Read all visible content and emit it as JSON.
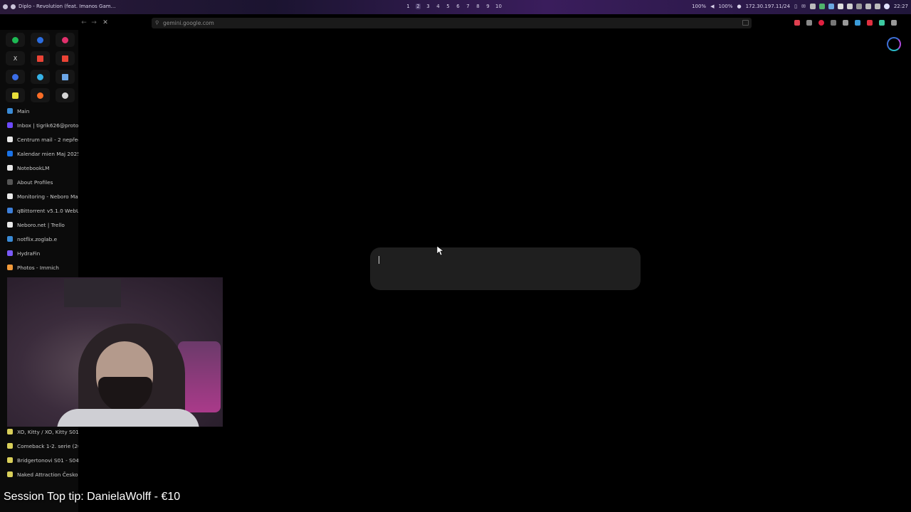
{
  "topbar": {
    "now_playing": "Diplo - Revolution (feat. Imanos Gam…",
    "workspaces": [
      "1",
      "2",
      "3",
      "4",
      "5",
      "6",
      "7",
      "8",
      "9",
      "10"
    ],
    "active_workspace": "2",
    "volume_left": "100%",
    "volume_right": "100%",
    "ip_address": "172.30.197.11/24",
    "clock": "22:27"
  },
  "browser": {
    "url": "gemini.google.com"
  },
  "sidebar": {
    "pinned_icons": [
      "spotify-icon",
      "messenger-icon",
      "instagram-icon",
      "x-icon",
      "gmail-icon",
      "gmail-icon",
      "chat-icon",
      "drop-icon",
      "screen-icon",
      "note-icon",
      "gitlab-icon",
      "circle-icon"
    ],
    "tabs": [
      {
        "label": "Main",
        "color": "#3a8bd6"
      },
      {
        "label": "Inbox | tigrik626@proto",
        "color": "#6d4aff"
      },
      {
        "label": "Centrum mail - 2 nepřeč",
        "color": "#e8e8e8"
      },
      {
        "label": "Kalendar mien Maj 2025",
        "color": "#1a73e8"
      },
      {
        "label": "NotebookLM",
        "color": "#e8e8e8"
      },
      {
        "label": "About Profiles",
        "color": "#555555"
      },
      {
        "label": "Monitoring - Neboro Ma",
        "color": "#e8e8e8"
      },
      {
        "label": "qBittorrent v5.1.0 WebU",
        "color": "#3d7fd9"
      },
      {
        "label": "Neboro.net | Trello",
        "color": "#e8e8e8"
      },
      {
        "label": "notflix.zoglab.e",
        "color": "#3a8bd6"
      },
      {
        "label": "HydraFin",
        "color": "#7a5af8"
      },
      {
        "label": "Photos - Immich",
        "color": "#f29a3a"
      }
    ],
    "tabs_bottom": [
      {
        "label": "XO, Kitty / XO, Kitty S01",
        "color": "#d9cf5a"
      },
      {
        "label": "Comeback 1-2. serie (20",
        "color": "#d9cf5a"
      },
      {
        "label": "Bridgertonovi S01 - S04",
        "color": "#d9cf5a"
      },
      {
        "label": "Naked Attraction Česko",
        "color": "#d9cf5a"
      }
    ]
  },
  "overlay": {
    "tip_text": "Session Top tip: DanielaWolff - €10"
  },
  "colors": {
    "accent_blue": "#3d6fd6",
    "prompt_bg": "#1f1f1f"
  }
}
